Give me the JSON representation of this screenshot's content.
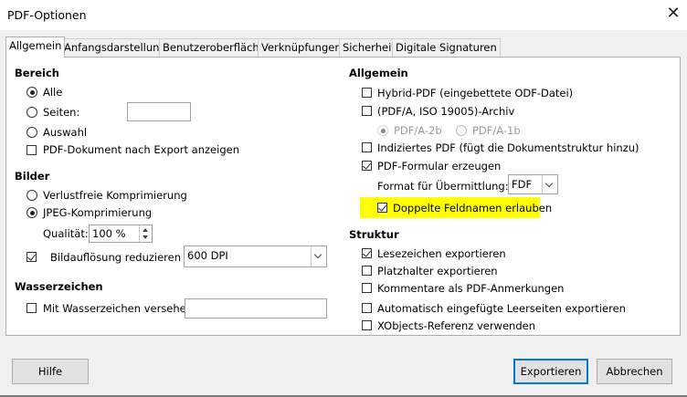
{
  "window": {
    "title": "PDF-Optionen",
    "close_glyph": "✕"
  },
  "tabs": [
    {
      "label": "Allgemein",
      "active": true
    },
    {
      "label": "Anfangsdarstellung"
    },
    {
      "label": "Benutzeroberfläche"
    },
    {
      "label": "Verknüpfungen"
    },
    {
      "label": "Sicherheit"
    },
    {
      "label": "Digitale Signaturen"
    }
  ],
  "left": {
    "bereich": {
      "heading": "Bereich",
      "alle": "Alle",
      "seiten": "Seiten:",
      "seiten_value": "",
      "auswahl": "Auswahl",
      "export_anzeigen": "PDF-Dokument nach Export anzeigen"
    },
    "bilder": {
      "heading": "Bilder",
      "verlustfrei": "Verlustfreie Komprimierung",
      "jpeg": "JPEG-Komprimierung",
      "qualitaet_label": "Qualität:",
      "qualitaet_value": "100 %",
      "aufloesung_label": "Bildauflösung reduzieren",
      "aufloesung_value": "600 DPI"
    },
    "wasserzeichen": {
      "heading": "Wasserzeichen",
      "label": "Mit Wasserzeichen versehen",
      "value": ""
    }
  },
  "right": {
    "allgemein": {
      "heading": "Allgemein",
      "hybrid": "Hybrid-PDF (eingebettete ODF-Datei)",
      "archiv": "(PDF/A, ISO 19005)-Archiv",
      "pdfa2b": "PDF/A-2b",
      "pdfa1b": "PDF/A-1b",
      "indiziert": "Indiziertes PDF (fügt die Dokumentstruktur hinzu)",
      "formular": "PDF-Formular erzeugen",
      "format_label": "Format für Übermittlung:",
      "format_value": "FDF",
      "doppelte": "Doppelte Feldnamen erlauben"
    },
    "struktur": {
      "heading": "Struktur",
      "lesezeichen": "Lesezeichen exportieren",
      "platzhalter": "Platzhalter exportieren",
      "kommentare": "Kommentare als PDF-Anmerkungen",
      "leerseiten": "Automatisch eingefügte Leerseiten exportieren",
      "xobjects": "XObjects-Referenz verwenden"
    }
  },
  "buttons": {
    "hilfe": "Hilfe",
    "exportieren": "Exportieren",
    "abbrechen": "Abbrechen"
  }
}
